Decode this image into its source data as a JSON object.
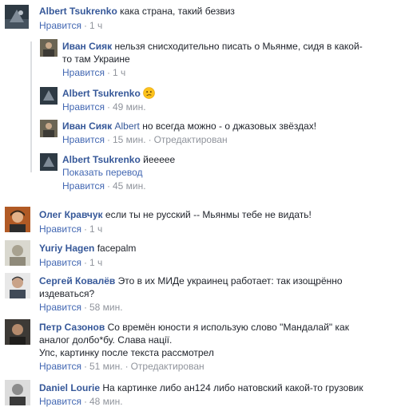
{
  "ui": {
    "like_label": "Нравится",
    "sep": "·",
    "translate_label": "Показать перевод"
  },
  "comments": [
    {
      "author": "Albert Tsukrenko",
      "text": "кака страна, такий безвиз",
      "time": "1 ч"
    },
    {
      "author": "Иван Сияк",
      "text": "нельзя снисходительно писать о Мьянме, сидя в какой-то там Украине",
      "line1": "нельзя снисходительно писать о Мьянме, сидя в какой-",
      "line2": "то там Украине",
      "time": "1 ч"
    },
    {
      "author": "Albert Tsukrenko",
      "emoji": "confused-face-emoji",
      "time": "49 мин."
    },
    {
      "author": "Иван Сияк",
      "mention": "Albert",
      "text": "но всегда можно - о джазовых звёздах!",
      "time": "15 мин.",
      "edited": "Отредактирован"
    },
    {
      "author": "Albert Tsukrenko",
      "text": "йеееее",
      "time": "45 мин."
    },
    {
      "author": "Олег Кравчук",
      "text": "если ты не русский -- Мьянмы тебе не видать!",
      "time": "1 ч"
    },
    {
      "author": "Yuriy Hagen",
      "text": "facepalm",
      "time": "1 ч"
    },
    {
      "author": "Сергей Ковалёв",
      "line1": "Это в их МИДе украинец работает: так изощрённо",
      "line2": "издеваться?",
      "time": "58 мин."
    },
    {
      "author": "Петр Сазонов",
      "line1": "Со времён юности я использую слово \"Мандалай\" как",
      "line2": "аналог долбо*бу. Слава нації.",
      "line3": "Упс, картинку после текста рассмотрел",
      "time": "51 мин.",
      "edited": "Отредактирован"
    },
    {
      "author": "Daniel Lourie",
      "text": "На картинке либо ан124 либо натовский какой-то грузовик",
      "time": "48 мин."
    }
  ],
  "colors": {
    "author": "#365899",
    "link": "#4267b2",
    "meta": "#90949c",
    "text": "#1d2129",
    "reply_line": "#dddfe2"
  }
}
